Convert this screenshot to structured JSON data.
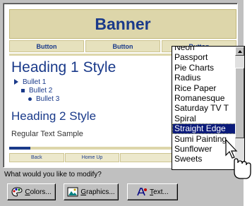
{
  "preview": {
    "banner_text": "Banner",
    "nav_buttons": [
      "Button",
      "Button",
      "Button"
    ],
    "heading1": "Heading 1 Style",
    "bullets": [
      "Bullet 1",
      "Bullet 2",
      "Bullet 3"
    ],
    "heading2": "Heading 2 Style",
    "regular_text": "Regular Text Sample",
    "bottom_nav": [
      "Back",
      "Home Up",
      ""
    ]
  },
  "theme_list": {
    "items": [
      "Neon",
      "Passport",
      "Pie Charts",
      "Radius",
      "Rice Paper",
      "Romanesque",
      "Saturday TV T",
      "Spiral",
      "Straight Edge",
      "Sumi Painting",
      "Sunflower",
      "Sweets"
    ],
    "selected": "Straight Edge"
  },
  "prompt": {
    "label": "What would you like to modify?"
  },
  "buttons": {
    "colors_label": "Colors...",
    "graphics_label": "Graphics...",
    "text_label": "Text..."
  },
  "icons": {
    "colors": "palette-icon",
    "graphics": "picture-icon",
    "text": "font-icon",
    "pointer": "hand-pointer-icon"
  },
  "colors": {
    "theme_navy": "#1a3a8a",
    "theme_khaki": "#ddd6aa",
    "selection": "#0a1a7a"
  }
}
